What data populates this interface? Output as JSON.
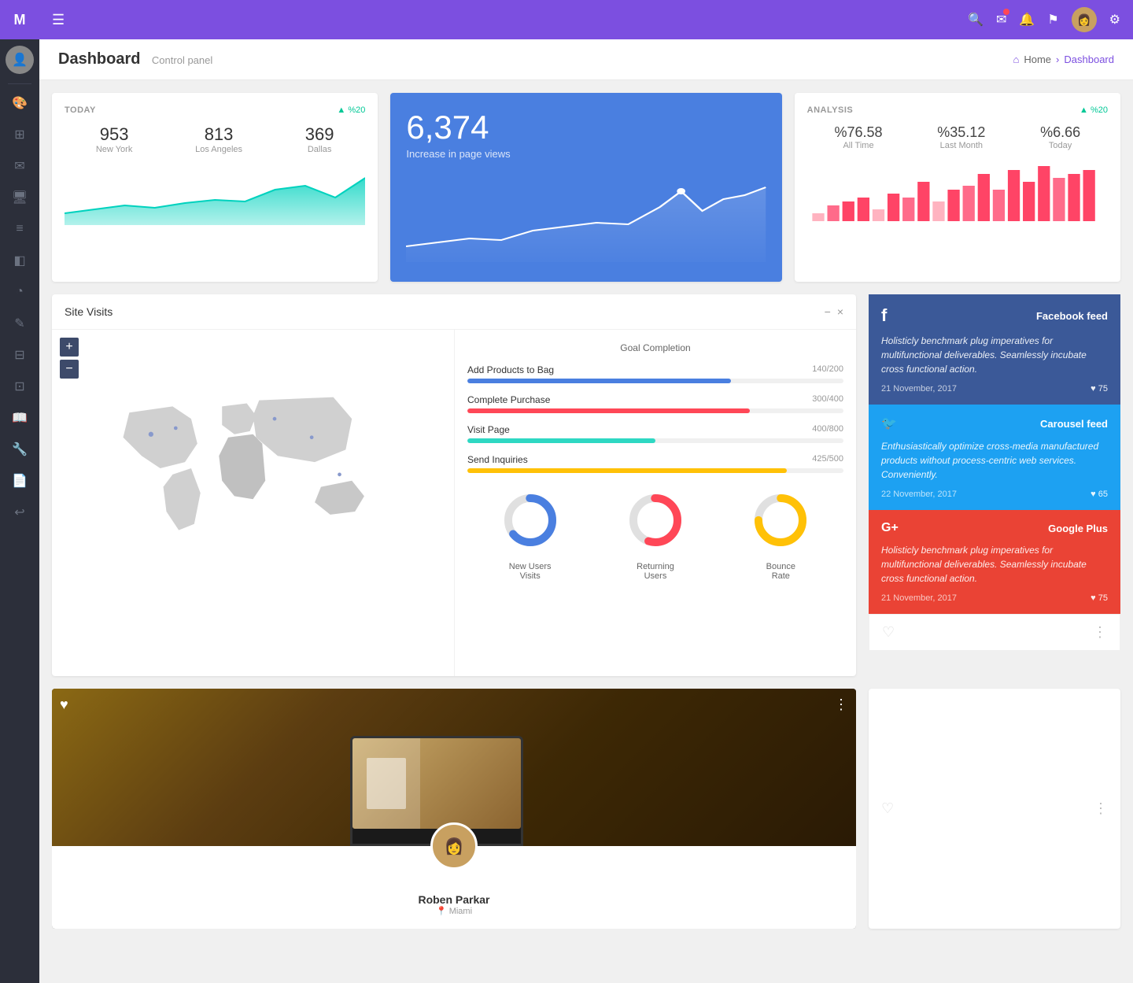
{
  "sidebar": {
    "logo": "M",
    "icons": [
      {
        "name": "menu-icon",
        "symbol": "☰",
        "active": false
      },
      {
        "name": "palette-icon",
        "symbol": "🎨",
        "active": true
      },
      {
        "name": "grid-icon",
        "symbol": "⊞",
        "active": false
      },
      {
        "name": "mail-icon",
        "symbol": "✉",
        "active": false
      },
      {
        "name": "monitor-icon",
        "symbol": "🖥",
        "active": false
      },
      {
        "name": "list-icon",
        "symbol": "≡",
        "active": false
      },
      {
        "name": "layers-icon",
        "symbol": "◫",
        "active": false
      },
      {
        "name": "chart-icon",
        "symbol": "◕",
        "active": false
      },
      {
        "name": "edit-icon",
        "symbol": "✎",
        "active": false
      },
      {
        "name": "table-icon",
        "symbol": "⊟",
        "active": false
      },
      {
        "name": "inbox-icon",
        "symbol": "⊡",
        "active": false
      },
      {
        "name": "book-icon",
        "symbol": "📖",
        "active": false
      },
      {
        "name": "wrench-icon",
        "symbol": "🔧",
        "active": false
      },
      {
        "name": "file-icon",
        "symbol": "📄",
        "active": false
      },
      {
        "name": "reply-icon",
        "symbol": "↩",
        "active": false
      }
    ]
  },
  "topbar": {
    "hamburger": "☰",
    "search_icon": "🔍",
    "mail_icon": "✉",
    "bell_icon": "🔔",
    "flag_icon": "⚑",
    "gear_icon": "⚙"
  },
  "breadcrumb": {
    "title": "Dashboard",
    "subtitle": "Control panel",
    "home_label": "Home",
    "current": "Dashboard"
  },
  "today_card": {
    "title": "TODAY",
    "badge": "▲ %20",
    "stats": [
      {
        "value": "953",
        "label": "New York"
      },
      {
        "value": "813",
        "label": "Los Angeles"
      },
      {
        "value": "369",
        "label": "Dallas"
      }
    ]
  },
  "big_card": {
    "number": "6,374",
    "label": "Increase in page views"
  },
  "analysis_card": {
    "title": "ANALYSIS",
    "badge": "▲ %20",
    "stats": [
      {
        "value": "%76.58",
        "label": "All Time"
      },
      {
        "value": "%35.12",
        "label": "Last Month"
      },
      {
        "value": "%6.66",
        "label": "Today"
      }
    ]
  },
  "site_visits": {
    "title": "Site Visits",
    "minimize": "−",
    "close": "×",
    "zoom_in": "+",
    "zoom_out": "−",
    "goals_title": "Goal Completion",
    "goals": [
      {
        "label": "Add Products to Bag",
        "current": 140,
        "total": 200,
        "color": "fill-blue",
        "pct": 70
      },
      {
        "label": "Complete Purchase",
        "current": 300,
        "total": 400,
        "color": "fill-red",
        "pct": 75
      },
      {
        "label": "Visit Page",
        "current": 400,
        "total": 800,
        "color": "fill-teal",
        "pct": 50
      },
      {
        "label": "Send Inquiries",
        "current": 425,
        "total": 500,
        "color": "fill-orange",
        "pct": 85
      }
    ],
    "donuts": [
      {
        "label": "New Users\nVisits",
        "value": 65,
        "color": "#4a7fe0"
      },
      {
        "label": "Returning\nUsers",
        "value": 55,
        "color": "#ff4757"
      },
      {
        "label": "Bounce\nRate",
        "value": 75,
        "color": "#ffc107"
      }
    ]
  },
  "social_feeds": [
    {
      "platform": "Facebook feed",
      "icon": "f",
      "bg_class": "social-card-facebook",
      "text": "Holisticly benchmark plug imperatives for multifunctional deliverables. Seamlessly incubate cross functional action.",
      "date": "21 November, 2017",
      "likes": "75"
    },
    {
      "platform": "Carousel feed",
      "icon": "𝕥",
      "bg_class": "social-card-twitter",
      "text": "Enthusiastically optimize cross-media manufactured products without process-centric web services. Conveniently.",
      "date": "22 November, 2017",
      "likes": "65"
    },
    {
      "platform": "Google Plus",
      "icon": "G+",
      "bg_class": "social-card-google",
      "text": "Holisticly benchmark plug imperatives for multifunctional deliverables. Seamlessly incubate cross functional action.",
      "date": "21 November, 2017",
      "likes": "75"
    }
  ],
  "photo_card": {
    "profile_name": "Roben Parkar",
    "profile_location": "Miami"
  }
}
